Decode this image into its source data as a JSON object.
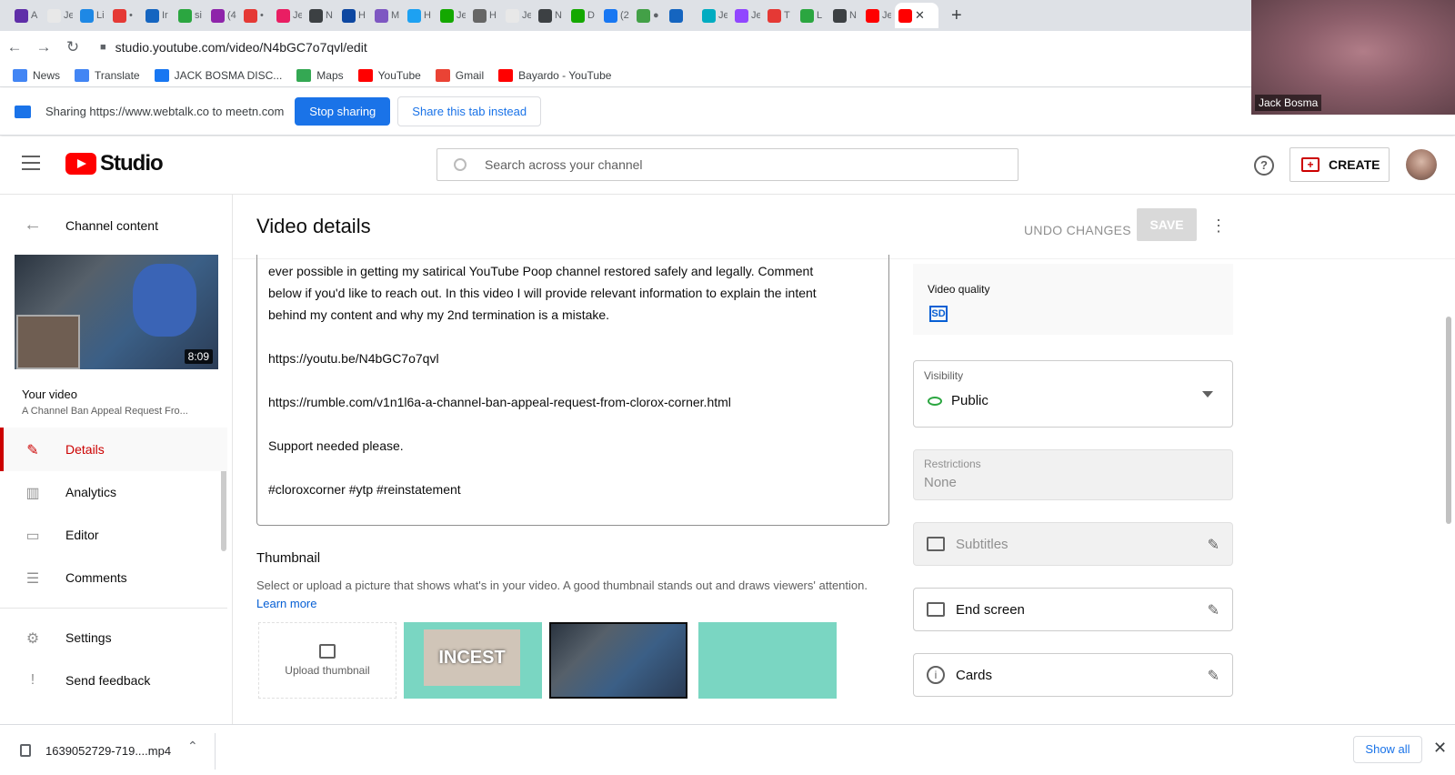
{
  "browser": {
    "tabs": [
      {
        "color": "#5f2ea8",
        "label": "A"
      },
      {
        "color": "#e8e8e8",
        "label": "Je"
      },
      {
        "color": "#1e88e5",
        "label": "Li"
      },
      {
        "color": "#e53935",
        "label": "•"
      },
      {
        "color": "#1565c0",
        "label": "Ir"
      },
      {
        "color": "#2ba640",
        "label": "si"
      },
      {
        "color": "#8e24aa",
        "label": "(4"
      },
      {
        "color": "#e53935",
        "label": "•"
      },
      {
        "color": "#e91e63",
        "label": "Je"
      },
      {
        "color": "#3c4043",
        "label": "N"
      },
      {
        "color": "#0d47a1",
        "label": "H"
      },
      {
        "color": "#7e57c2",
        "label": "M"
      },
      {
        "color": "#1da1f2",
        "label": "H"
      },
      {
        "color": "#14a800",
        "label": "Je"
      },
      {
        "color": "#666666",
        "label": "H"
      },
      {
        "color": "#e8e8e8",
        "label": "Je"
      },
      {
        "color": "#3c4043",
        "label": "N"
      },
      {
        "color": "#14a800",
        "label": "D"
      },
      {
        "color": "#1877f2",
        "label": "(2"
      },
      {
        "color": "#43a047",
        "label": "●"
      },
      {
        "color": "#1565c0",
        "label": ""
      },
      {
        "color": "#00acc1",
        "label": "Je"
      },
      {
        "color": "#9146ff",
        "label": "Je"
      },
      {
        "color": "#e53935",
        "label": "T"
      },
      {
        "color": "#2ba640",
        "label": "L"
      },
      {
        "color": "#3c4043",
        "label": "N"
      },
      {
        "color": "#ff0000",
        "label": "Je"
      }
    ],
    "active_tab": {
      "color": "#ff0000",
      "close": "✕"
    },
    "new_tab": "+",
    "url": "studio.youtube.com/video/N4bGC7o7qvl/edit",
    "bookmarks": [
      {
        "label": "News",
        "color": "#4285f4"
      },
      {
        "label": "Translate",
        "color": "#4285f4"
      },
      {
        "label": "JACK BOSMA DISC...",
        "color": "#1877f2"
      },
      {
        "label": "Maps",
        "color": "#34a853"
      },
      {
        "label": "YouTube",
        "color": "#ff0000"
      },
      {
        "label": "Gmail",
        "color": "#ea4335"
      },
      {
        "label": "Bayardo - YouTube",
        "color": "#ff0000"
      }
    ]
  },
  "sharing": {
    "message": "Sharing https://www.webtalk.co to meetn.com",
    "stop_label": "Stop sharing",
    "share_tab_label": "Share this tab instead"
  },
  "webcam": {
    "name": "Jack Bosma"
  },
  "header": {
    "logo_text": "Studio",
    "search_placeholder": "Search across your channel",
    "help": "?",
    "create_label": "CREATE"
  },
  "sidebar": {
    "channel_content": "Channel content",
    "thumb_duration": "8:09",
    "your_video": "Your video",
    "video_title": "A Channel Ban Appeal Request Fro...",
    "items": [
      {
        "label": "Details",
        "icon": "✎"
      },
      {
        "label": "Analytics",
        "icon": "▥"
      },
      {
        "label": "Editor",
        "icon": "▭"
      },
      {
        "label": "Comments",
        "icon": "☰"
      },
      {
        "label": "Settings",
        "icon": "⚙"
      },
      {
        "label": "Send feedback",
        "icon": "!"
      }
    ]
  },
  "main": {
    "title": "Video details",
    "undo_label": "UNDO CHANGES",
    "save_label": "SAVE",
    "description_lines": [
      "ever possible in getting my satirical YouTube Poop channel restored safely and legally. Comment",
      "below if you'd like to reach out. In this video I will provide  relevant information to explain the intent",
      "behind my content and why my 2nd termination is a mistake.",
      "",
      "https://youtu.be/N4bGC7o7qvl",
      "",
      "https://rumble.com/v1n1l6a-a-channel-ban-appeal-request-from-clorox-corner.html",
      "",
      "Support needed please.",
      "",
      " #cloroxcorner #ytp #reinstatement"
    ],
    "thumbnail_heading": "Thumbnail",
    "thumbnail_desc": "Select or upload a picture that shows what's in your video. A good thumbnail stands out and draws viewers' attention.",
    "learn_more": "Learn more",
    "upload_label": "Upload thumbnail",
    "thumb1_text": "INCEST"
  },
  "right": {
    "video_quality_label": "Video quality",
    "video_quality_badge": "SD",
    "visibility_label": "Visibility",
    "visibility_value": "Public",
    "restrictions_label": "Restrictions",
    "restrictions_value": "None",
    "subtitles_label": "Subtitles",
    "end_screen_label": "End screen",
    "cards_label": "Cards",
    "cards_icon": "i"
  },
  "downloads": {
    "file_name": "1639052729-719....mp4",
    "show_all": "Show all"
  }
}
